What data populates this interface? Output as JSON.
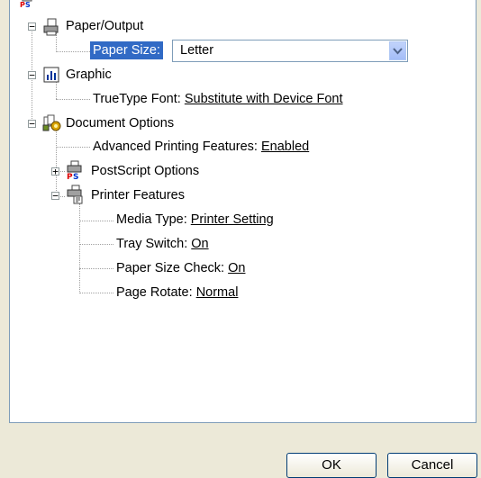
{
  "tree": {
    "paper_output": {
      "label": "Paper/Output"
    },
    "paper_size": {
      "label": "Paper Size:",
      "value": "Letter"
    },
    "graphic": {
      "label": "Graphic"
    },
    "truetype_font": {
      "label": "TrueType Font:",
      "value": "Substitute with Device Font"
    },
    "document_options": {
      "label": "Document Options"
    },
    "advanced_printing": {
      "label": "Advanced Printing Features:",
      "value": "Enabled"
    },
    "postscript_options": {
      "label": "PostScript Options"
    },
    "printer_features": {
      "label": "Printer Features"
    },
    "media_type": {
      "label": "Media Type:",
      "value": "Printer Setting"
    },
    "tray_switch": {
      "label": "Tray Switch:",
      "value": "On"
    },
    "paper_size_check": {
      "label": "Paper Size Check:",
      "value": "On"
    },
    "page_rotate": {
      "label": "Page Rotate:",
      "value": "Normal"
    }
  },
  "buttons": {
    "ok": "OK",
    "cancel": "Cancel"
  },
  "icons": {
    "ps_icon": "postscript-icon",
    "printer_paper_icon": "printer-paper-icon",
    "graphic_icon": "bar-chart-icon",
    "document_icon": "document-options-icon",
    "printer_features_icon": "printer-features-icon"
  },
  "colors": {
    "selection": "#316ac5",
    "background": "#ece9d8",
    "link_text": "#000000"
  }
}
